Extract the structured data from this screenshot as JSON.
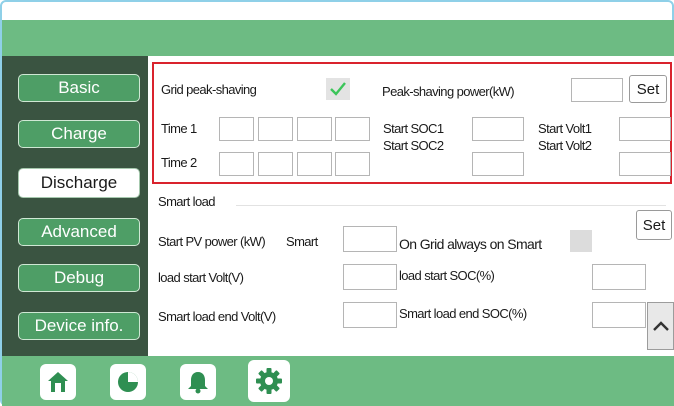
{
  "sidebar": {
    "items": [
      {
        "label": "Basic"
      },
      {
        "label": "Charge"
      },
      {
        "label": "Discharge",
        "active": true
      },
      {
        "label": "Advanced"
      },
      {
        "label": "Debug"
      },
      {
        "label": "Device info."
      }
    ]
  },
  "peak": {
    "grid_label": "Grid peak-shaving",
    "grid_checked": true,
    "power_label": "Peak-shaving power(kW)",
    "power_value": "",
    "set_label": "Set",
    "time1_label": "Time 1",
    "time2_label": "Time 2",
    "start_soc1_label": "Start SOC1",
    "start_soc2_label": "Start SOC2",
    "start_volt1_label": "Start Volt1",
    "start_volt2_label": "Start Volt2"
  },
  "smartload": {
    "section_title": "Smart load",
    "set_label": "Set",
    "start_pv_label": "Start PV power (kW)",
    "smart_word": "Smart",
    "load_start_volt_label": "load start Volt(V)",
    "end_volt_label": "Smart load end Volt(V)",
    "on_grid_label": "On  Grid  always  on  Smart",
    "load_start_soc_label": "load start SOC(%)",
    "end_soc_label": "Smart load end SOC(%)"
  },
  "nav": {
    "icons": [
      "home-icon",
      "pie-chart-icon",
      "bell-icon",
      "gear-icon"
    ]
  },
  "colors": {
    "header_green": "#6dbb83",
    "sidebar_dark": "#3a5441",
    "button_green": "#4e9e66",
    "highlight_red": "#d9232d",
    "check_green": "#3cc55a"
  }
}
